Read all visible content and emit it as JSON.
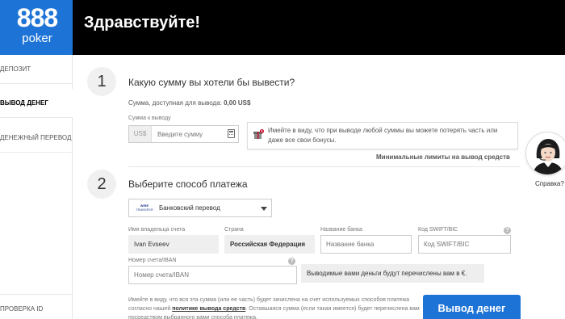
{
  "brand": {
    "number": "888",
    "word": "poker",
    "color": "#1e74d6"
  },
  "header": {
    "title": "Здравствуйте!"
  },
  "sidebar": {
    "items": [
      {
        "label": "ДЕПОЗИТ",
        "active": false
      },
      {
        "label": "ВЫВОД ДЕНЕГ",
        "active": true
      },
      {
        "label": "ДЕНЕЖНЫЙ ПЕРЕВОД",
        "active": false
      },
      {
        "label": "ПРОВЕРКА ID",
        "active": false
      }
    ]
  },
  "step1": {
    "number": "1",
    "title": "Какую сумму вы хотели бы вывести?",
    "available_label": "Сумма, доступная для вывода:",
    "available_value": "0,00 US$",
    "amount_label": "Сумма к выводу",
    "currency": "US$",
    "amount_placeholder": "Введите сумму",
    "warning": "Имейте в виду, что при выводе любой суммы вы можете потерять часть или даже все свои бонусы.",
    "min_limits": "Минимальные лимиты на вывод средств"
  },
  "step2": {
    "number": "2",
    "title": "Выберите способ платежа",
    "method": {
      "badge_top": "WIRE",
      "badge_bottom": "TRANSFER",
      "label": "Банковский перевод"
    },
    "holder": {
      "label": "Имя владельца счета",
      "value": "Ivan Evseev"
    },
    "country": {
      "label": "Страна",
      "value": "Российская Федерация"
    },
    "bank": {
      "label": "Название банка",
      "placeholder": "Название банка"
    },
    "swift": {
      "label": "Код SWIFT/BIC",
      "placeholder": "Код SWIFT/BIC"
    },
    "account": {
      "label": "Номер счета/IBAN",
      "placeholder": "Номер счета/IBAN"
    },
    "notice": "Выводимые вами деньги будут перечислены вам в €.",
    "footer_pre": "Имейте в виду, что вся эта сумма (или ее часть) будет зачислена на счет используемых способов платежа согласно нашей ",
    "footer_link": "политике вывода средств",
    "footer_post": ". Оставшаяся сумма (если такая имеется) будет перечислена вам посредством выбранного вами способа платежа.",
    "submit": "Вывод денег"
  },
  "help_widget": {
    "label": "Справка?"
  },
  "help_mark": "?"
}
